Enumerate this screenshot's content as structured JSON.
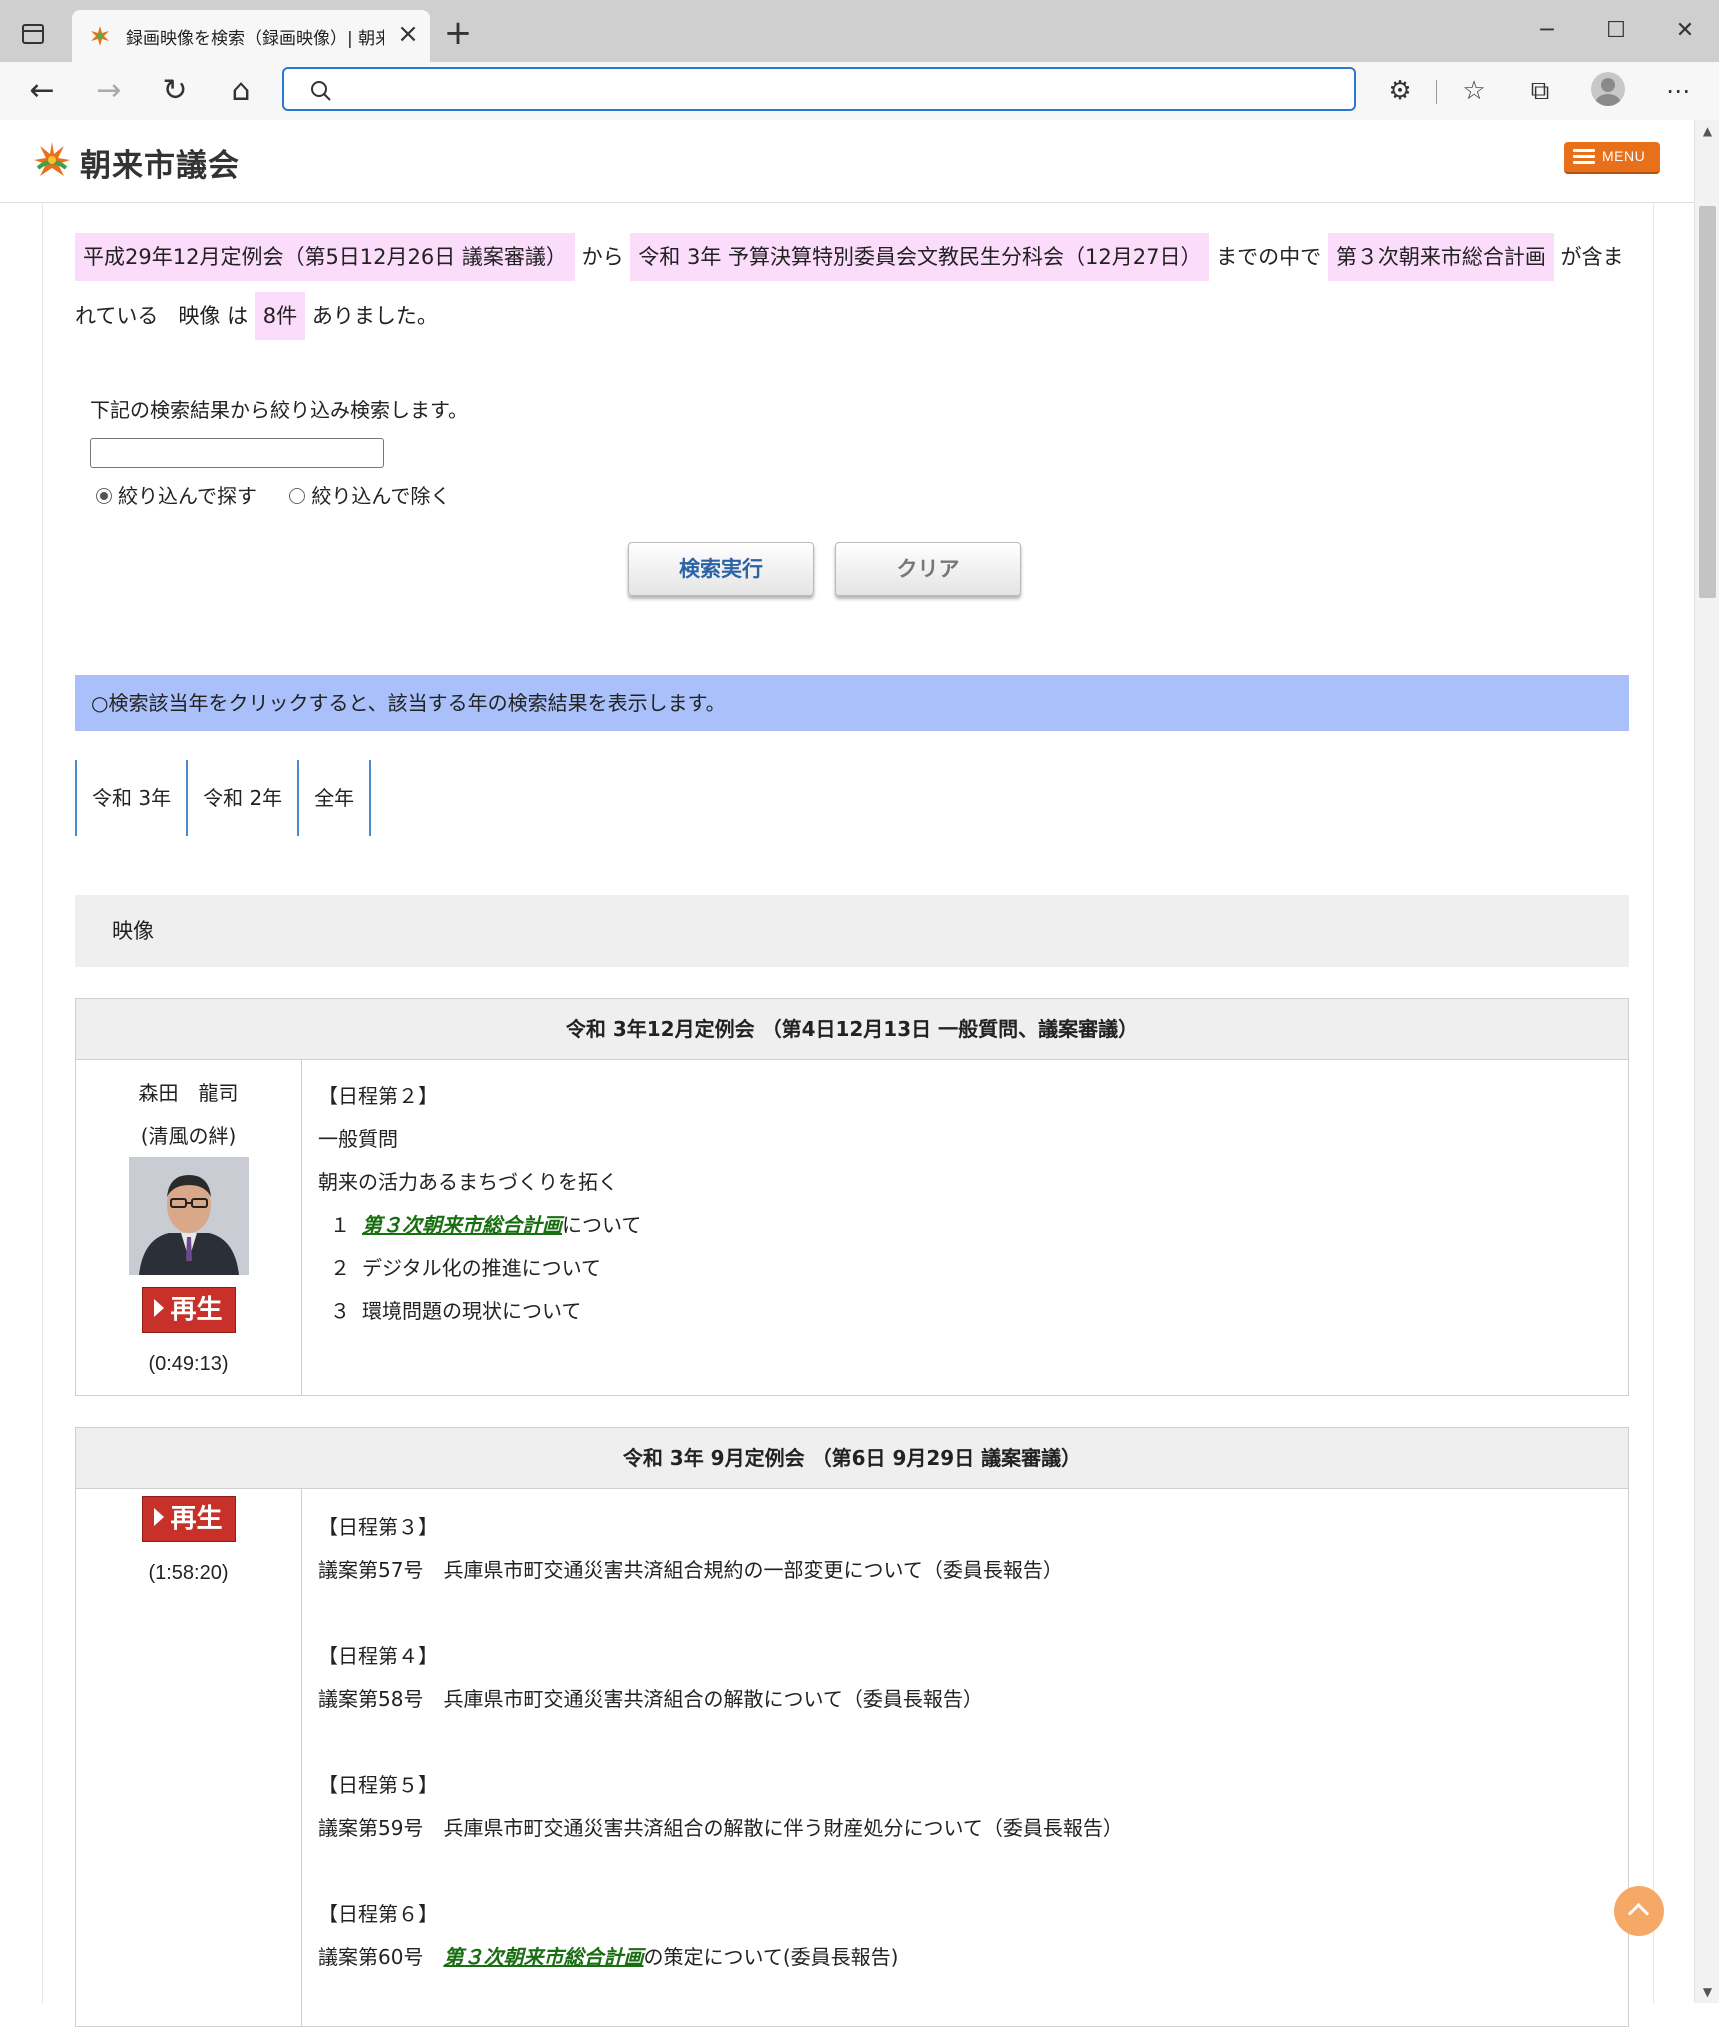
{
  "browser": {
    "tab_title": "録画映像を検索（録画映像）| 朝来市議会",
    "new_tab_label": "+",
    "address_value": "",
    "colors": {
      "accent": "#2a78d4"
    }
  },
  "site": {
    "logo_text": "朝来市議会",
    "menu_label": "MENU",
    "colors": {
      "menu": "#e8701a",
      "highlight": "#fbdcfb",
      "notice": "#a9c0fb",
      "keyword": "#1a6e12"
    }
  },
  "summary": {
    "from_value": "平成29年12月定例会（第5日12月26日 議案審議）",
    "from_word": "から",
    "to_value": "令和 3年 予算決算特別委員会文教民生分科会（12月27日）",
    "to_word": "までの中で",
    "keyword": "第３次朝来市総合計画",
    "contains_word": "が含まれている",
    "type_word": "映像",
    "is_word": "は",
    "count": "8件",
    "end_word": "ありました。"
  },
  "refine": {
    "label": "下記の検索結果から絞り込み検索します。",
    "input_value": "",
    "option_include": "絞り込んで探す",
    "option_exclude": "絞り込んで除く",
    "search_button": "検索実行",
    "clear_button": "クリア"
  },
  "year_notice": "○検索該当年をクリックすると、該当する年の検索結果を表示します。",
  "year_tabs": [
    "令和 3年",
    "令和 2年",
    "全年"
  ],
  "video_header": "映像",
  "records": [
    {
      "title": "令和 3年12月定例会 （第4日12月13日 一般質問、議案審議）",
      "speaker_name": "森田　龍司",
      "speaker_party": "(清風の絆)",
      "play_label": "再生",
      "duration": "(0:49:13)",
      "lines": {
        "l1": "【日程第２】",
        "l2": "一般質問",
        "l3": "朝来の活力あるまちづくりを拓く",
        "i1_num": "１",
        "i1_kw": "第３次朝来市総合計画",
        "i1_rest": "について",
        "i2_num": "２",
        "i2_text": "デジタル化の推進について",
        "i3_num": "３",
        "i3_text": "環境問題の現状について"
      }
    },
    {
      "title": "令和 3年 9月定例会 （第6日 9月29日 議案審議）",
      "play_label": "再生",
      "duration": "(1:58:20)",
      "lines": {
        "a_head": "【日程第３】",
        "a_text": "議案第57号　兵庫県市町交通災害共済組合規約の一部変更について（委員長報告）",
        "b_head": "【日程第４】",
        "b_text": "議案第58号　兵庫県市町交通災害共済組合の解散について（委員長報告）",
        "c_head": "【日程第５】",
        "c_text": "議案第59号　兵庫県市町交通災害共済組合の解散に伴う財産処分について（委員長報告）",
        "d_head": "【日程第６】",
        "d_pre": "議案第60号　",
        "d_kw": "第３次朝来市総合計画",
        "d_rest": "の策定について(委員長報告)"
      }
    }
  ]
}
